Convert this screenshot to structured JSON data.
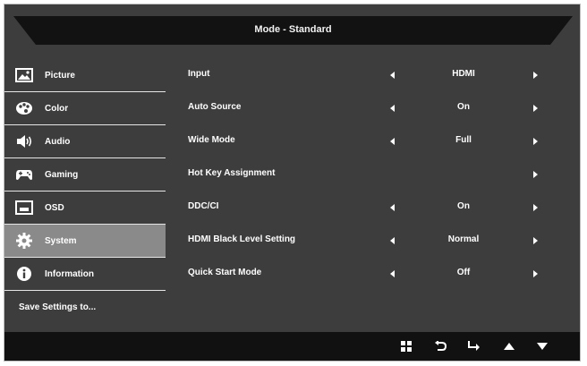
{
  "header": {
    "title": "Mode - Standard"
  },
  "sidebar": {
    "items": [
      {
        "label": "Picture",
        "icon": "picture-icon"
      },
      {
        "label": "Color",
        "icon": "palette-icon"
      },
      {
        "label": "Audio",
        "icon": "speaker-icon"
      },
      {
        "label": "Gaming",
        "icon": "gamepad-icon"
      },
      {
        "label": "OSD",
        "icon": "osd-icon"
      },
      {
        "label": "System",
        "icon": "gear-icon"
      },
      {
        "label": "Information",
        "icon": "info-icon"
      }
    ],
    "save_label": "Save Settings to..."
  },
  "settings": [
    {
      "label": "Input",
      "value": "HDMI"
    },
    {
      "label": "Auto Source",
      "value": "On"
    },
    {
      "label": "Wide Mode",
      "value": "Full"
    },
    {
      "label": "Hot Key Assignment",
      "value": ""
    },
    {
      "label": "DDC/CI",
      "value": "On"
    },
    {
      "label": "HDMI Black Level Setting",
      "value": "Normal"
    },
    {
      "label": "Quick Start Mode",
      "value": "Off"
    }
  ],
  "bottom_nav": [
    "menu-grid-icon",
    "back-icon",
    "enter-icon",
    "up-arrow-icon",
    "down-arrow-icon"
  ],
  "colors": {
    "panel": "#3d3d3d",
    "title_bar": "#121212",
    "active_item": "#8a8a8a",
    "bottom_bar": "#111111"
  }
}
